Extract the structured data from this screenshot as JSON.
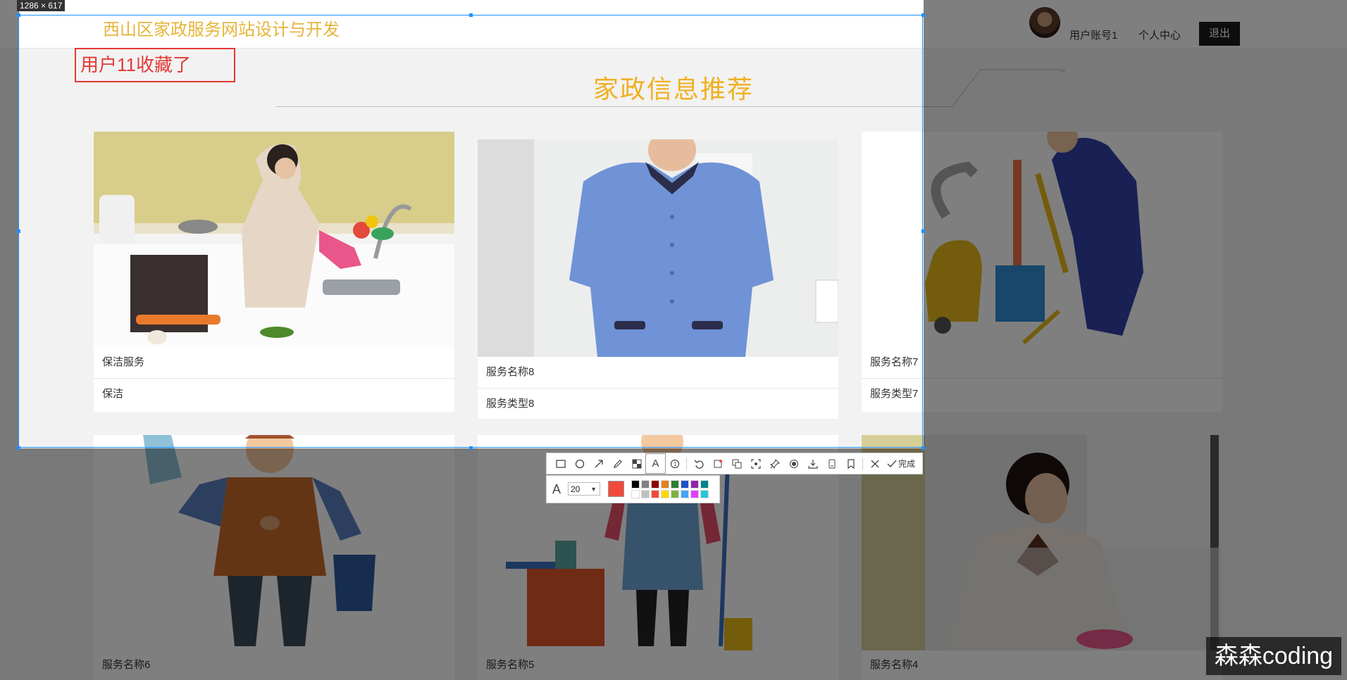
{
  "site": {
    "title": "西山区家政服务网站设计与开发"
  },
  "nav": {
    "user": "用户账号1",
    "center": "个人中心",
    "logout": "退出"
  },
  "section": {
    "title": "家政信息推荐"
  },
  "cards": [
    {
      "name": "保洁服务",
      "type": "保洁"
    },
    {
      "name": "服务名称8",
      "type": "服务类型8"
    },
    {
      "name": "服务名称7",
      "type": "服务类型7"
    },
    {
      "name": "服务名称6"
    },
    {
      "name": "服务名称5"
    },
    {
      "name": "服务名称4"
    }
  ],
  "capture": {
    "size_label": "1286 × 617",
    "annotation_text": "用户11收藏了",
    "toolbar": {
      "icons": [
        "rectangle-icon",
        "ellipse-icon",
        "arrow-icon",
        "pencil-icon",
        "mosaic-icon",
        "text-icon",
        "serial-number-icon",
        "undo-icon",
        "ocr-icon",
        "translate-icon",
        "scroll-capture-icon",
        "pin-icon",
        "record-icon",
        "save-icon",
        "long-screenshot-icon",
        "bookmark-icon",
        "close-icon"
      ],
      "done": "完成",
      "font_size": "20"
    },
    "current_color": "#f04a3a",
    "palette": [
      "#000000",
      "#808080",
      "#8b0000",
      "#e67e22",
      "#2e7d32",
      "#1e50c8",
      "#8e24aa",
      "#00838f",
      "#ffffff",
      "#c0c0c0",
      "#f04a3a",
      "#ffd700",
      "#7cb342",
      "#42a5f5",
      "#e040fb",
      "#26c6da"
    ]
  },
  "watermark": "森森coding"
}
